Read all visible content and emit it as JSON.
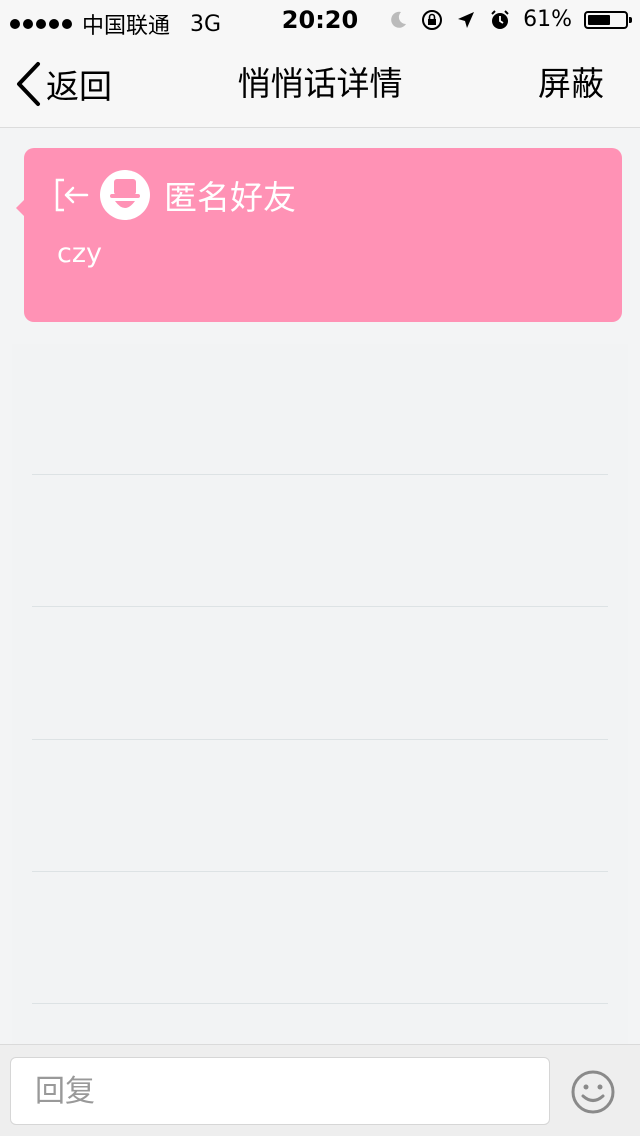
{
  "status_bar": {
    "carrier": "中国联通",
    "network": "3G",
    "time": "20:20",
    "battery_percent": "61%",
    "battery_level": 0.61,
    "icons": [
      "moon-icon",
      "orientation-lock-icon",
      "location-arrow-icon",
      "alarm-icon",
      "battery-icon"
    ]
  },
  "nav": {
    "back_label": "返回",
    "title": "悄悄话详情",
    "right_label": "屏蔽"
  },
  "message": {
    "sender": "匿名好友",
    "text": "czy",
    "card_color": "#ff92b5"
  },
  "reply_bar": {
    "placeholder": "回复"
  },
  "colors": {
    "background": "#f3f4f5",
    "accent_pink": "#ff92b5",
    "bar_background": "#f7f7f7"
  }
}
